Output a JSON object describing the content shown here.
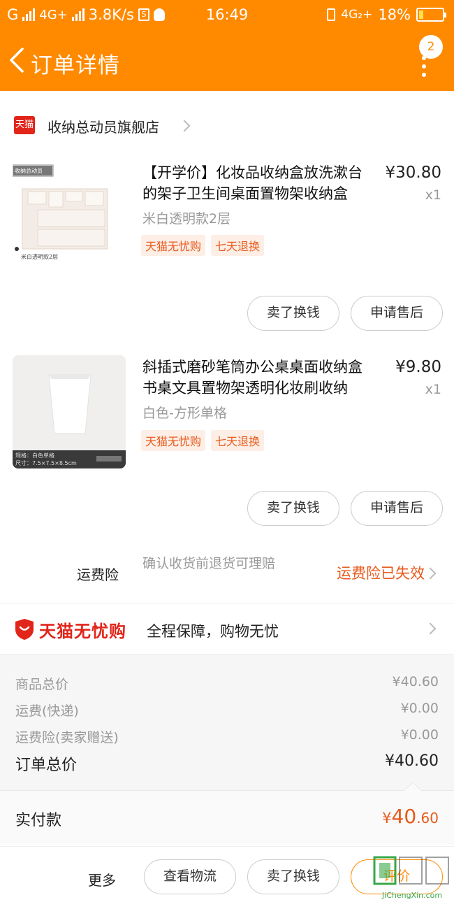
{
  "status_bar": {
    "carrier": "G",
    "network": "4G+",
    "speed": "3.8K/s",
    "time": "16:49",
    "network_right": "4G₂+",
    "battery": "18%"
  },
  "header": {
    "title": "订单详情",
    "badge_count": "2"
  },
  "shop": {
    "logo_text": "天猫",
    "name": "收纳总动员旗舰店"
  },
  "items": [
    {
      "title": "【开学价】化妆品收纳盒放洗漱台的架子卫生间桌面置物架收纳盒",
      "price": "¥30.80",
      "qty": "x1",
      "spec": "米白透明款2层",
      "tags": [
        "天猫无忧购",
        "七天退换"
      ],
      "thumb_badge": "收纳总动员",
      "thumb_caption": "米白透明款2层",
      "buttons": [
        "卖了换钱",
        "申请售后"
      ]
    },
    {
      "title": "斜插式磨砂笔筒办公桌桌面收纳盒书桌文具置物架透明化妆刷收纳",
      "price": "¥9.80",
      "qty": "x1",
      "spec": "白色-方形单格",
      "tags": [
        "天猫无忧购",
        "七天退换"
      ],
      "thumb_caption1": "规格：白色单格",
      "thumb_caption2": "尺寸：7.5×7.5×8.5cm",
      "buttons": [
        "卖了换钱",
        "申请售后"
      ]
    }
  ],
  "insurance": {
    "label": "运费险",
    "desc": "确认收货前退货可理赔",
    "status": "运费险已失效"
  },
  "worry_free": {
    "logo_text": "天猫无忧购",
    "desc": "全程保障，购物无忧"
  },
  "summary": {
    "rows": [
      {
        "label": "商品总价",
        "value": "¥40.60"
      },
      {
        "label": "运费(快递)",
        "value": "¥0.00"
      },
      {
        "label": "运费险(卖家赠送)",
        "value": "¥0.00"
      }
    ],
    "total_label": "订单总价",
    "total_value": "¥40.60"
  },
  "paid": {
    "label": "实付款",
    "currency": "¥",
    "integer": "40",
    "decimal": ".60"
  },
  "footer": {
    "more": "更多",
    "buttons": [
      "查看物流",
      "卖了换钱",
      "评价"
    ]
  },
  "watermark": {
    "text": "JiChengXin.com"
  },
  "colors": {
    "brand": "#ff8a00",
    "accent": "#e85a1c",
    "tmall_red": "#e1251b"
  }
}
